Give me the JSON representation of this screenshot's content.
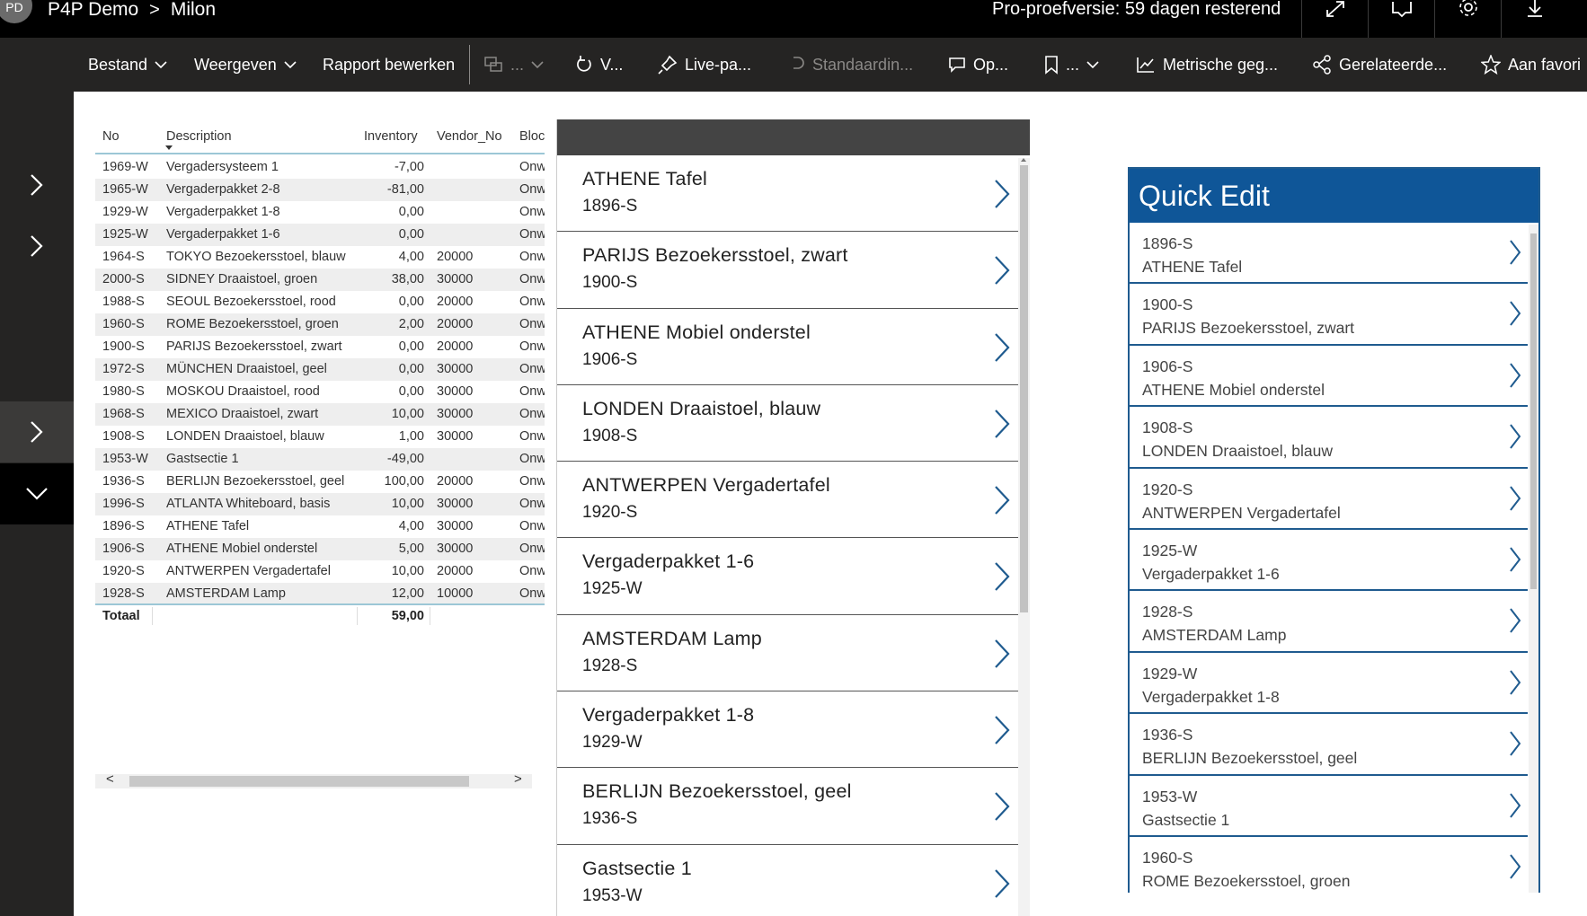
{
  "titlebar": {
    "avatar_initials": "PD",
    "workspace": "P4P Demo",
    "separator": ">",
    "report": "Milon",
    "trial_text": "Pro-proefversie: 59 dagen resterend",
    "icons": [
      "expand-icon",
      "comment-icon",
      "settings-gear-icon",
      "download-icon"
    ]
  },
  "commandbar": {
    "file": "Bestand",
    "view": "Weergeven",
    "edit_report": "Rapport bewerken",
    "item_disabled_1": "...",
    "refresh": "V...",
    "pin_live": "Live-pa...",
    "reset_default": "Standaardin...",
    "comments": "Op...",
    "bookmark": "...",
    "metrics": "Metrische geg...",
    "related": "Gerelateerde...",
    "favorite": "Aan favori"
  },
  "table": {
    "headers": {
      "no": "No",
      "description": "Description",
      "inventory": "Inventory",
      "vendor_no": "Vendor_No",
      "blocked": "Bloc"
    },
    "rows": [
      {
        "no": "1969-W",
        "desc": "Vergadersysteem 1",
        "inv": "-7,00",
        "ven": "",
        "bl": "Onw"
      },
      {
        "no": "1965-W",
        "desc": "Vergaderpakket 2-8",
        "inv": "-81,00",
        "ven": "",
        "bl": "Onw"
      },
      {
        "no": "1929-W",
        "desc": "Vergaderpakket 1-8",
        "inv": "0,00",
        "ven": "",
        "bl": "Onw"
      },
      {
        "no": "1925-W",
        "desc": "Vergaderpakket 1-6",
        "inv": "0,00",
        "ven": "",
        "bl": "Onw"
      },
      {
        "no": "1964-S",
        "desc": "TOKYO Bezoekersstoel, blauw",
        "inv": "4,00",
        "ven": "20000",
        "bl": "Onw"
      },
      {
        "no": "2000-S",
        "desc": "SIDNEY Draaistoel, groen",
        "inv": "38,00",
        "ven": "30000",
        "bl": "Onw"
      },
      {
        "no": "1988-S",
        "desc": "SEOUL Bezoekersstoel, rood",
        "inv": "0,00",
        "ven": "20000",
        "bl": "Onw"
      },
      {
        "no": "1960-S",
        "desc": "ROME Bezoekersstoel, groen",
        "inv": "2,00",
        "ven": "20000",
        "bl": "Onw"
      },
      {
        "no": "1900-S",
        "desc": "PARIJS Bezoekersstoel, zwart",
        "inv": "0,00",
        "ven": "20000",
        "bl": "Onw"
      },
      {
        "no": "1972-S",
        "desc": "MÜNCHEN Draaistoel, geel",
        "inv": "0,00",
        "ven": "30000",
        "bl": "Onw"
      },
      {
        "no": "1980-S",
        "desc": "MOSKOU Draaistoel, rood",
        "inv": "0,00",
        "ven": "30000",
        "bl": "Onw"
      },
      {
        "no": "1968-S",
        "desc": "MEXICO Draaistoel, zwart",
        "inv": "10,00",
        "ven": "30000",
        "bl": "Onw"
      },
      {
        "no": "1908-S",
        "desc": "LONDEN Draaistoel, blauw",
        "inv": "1,00",
        "ven": "30000",
        "bl": "Onw"
      },
      {
        "no": "1953-W",
        "desc": "Gastsectie 1",
        "inv": "-49,00",
        "ven": "",
        "bl": "Onw"
      },
      {
        "no": "1936-S",
        "desc": "BERLIJN Bezoekersstoel, geel",
        "inv": "100,00",
        "ven": "20000",
        "bl": "Onw"
      },
      {
        "no": "1996-S",
        "desc": "ATLANTA Whiteboard, basis",
        "inv": "10,00",
        "ven": "30000",
        "bl": "Onw"
      },
      {
        "no": "1896-S",
        "desc": "ATHENE Tafel",
        "inv": "4,00",
        "ven": "30000",
        "bl": "Onw"
      },
      {
        "no": "1906-S",
        "desc": "ATHENE Mobiel onderstel",
        "inv": "5,00",
        "ven": "30000",
        "bl": "Onw"
      },
      {
        "no": "1920-S",
        "desc": "ANTWERPEN Vergadertafel",
        "inv": "10,00",
        "ven": "20000",
        "bl": "Onw"
      },
      {
        "no": "1928-S",
        "desc": "AMSTERDAM Lamp",
        "inv": "12,00",
        "ven": "10000",
        "bl": "Onw"
      }
    ],
    "total_label": "Totaal",
    "total_value": "59,00",
    "scroll_left": "<",
    "scroll_right": ">"
  },
  "gallery": {
    "items": [
      {
        "title": "ATHENE Tafel",
        "code": "1896-S"
      },
      {
        "title": "PARIJS Bezoekersstoel, zwart",
        "code": "1900-S"
      },
      {
        "title": "ATHENE Mobiel onderstel",
        "code": "1906-S"
      },
      {
        "title": "LONDEN Draaistoel, blauw",
        "code": "1908-S"
      },
      {
        "title": "ANTWERPEN Vergadertafel",
        "code": "1920-S"
      },
      {
        "title": "Vergaderpakket 1-6",
        "code": "1925-W"
      },
      {
        "title": "AMSTERDAM Lamp",
        "code": "1928-S"
      },
      {
        "title": "Vergaderpakket 1-8",
        "code": "1929-W"
      },
      {
        "title": "BERLIJN Bezoekersstoel, geel",
        "code": "1936-S"
      },
      {
        "title": "Gastsectie 1",
        "code": "1953-W"
      }
    ]
  },
  "quick_edit": {
    "title": "Quick Edit",
    "items": [
      {
        "code": "1896-S",
        "name": "ATHENE Tafel"
      },
      {
        "code": "1900-S",
        "name": "PARIJS Bezoekersstoel, zwart"
      },
      {
        "code": "1906-S",
        "name": "ATHENE Mobiel onderstel"
      },
      {
        "code": "1908-S",
        "name": "LONDEN Draaistoel, blauw"
      },
      {
        "code": "1920-S",
        "name": "ANTWERPEN Vergadertafel"
      },
      {
        "code": "1925-W",
        "name": "Vergaderpakket 1-6"
      },
      {
        "code": "1928-S",
        "name": "AMSTERDAM Lamp"
      },
      {
        "code": "1929-W",
        "name": "Vergaderpakket 1-8"
      },
      {
        "code": "1936-S",
        "name": "BERLIJN Bezoekersstoel, geel"
      },
      {
        "code": "1953-W",
        "name": "Gastsectie 1"
      },
      {
        "code": "1960-S",
        "name": "ROME Bezoekersstoel, groen"
      }
    ]
  },
  "colors": {
    "accent": "#0f5698",
    "titlebar": "#000000",
    "commandbar": "#252423",
    "chevron": "#1f5b8f"
  }
}
